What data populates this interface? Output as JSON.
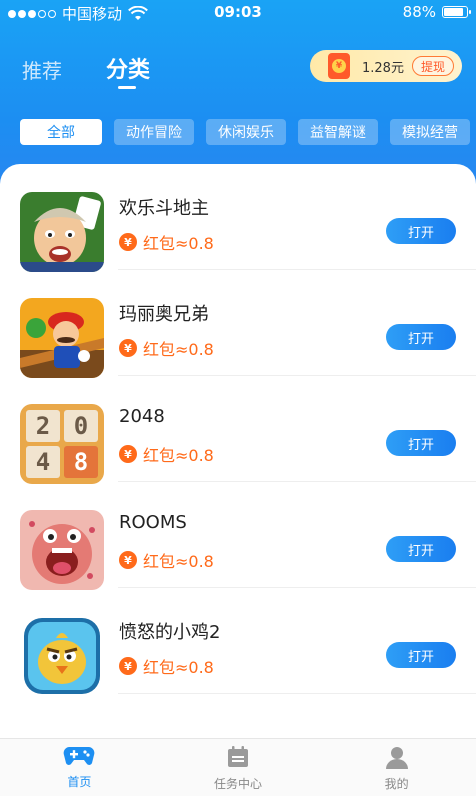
{
  "status_bar": {
    "carrier": "中国移动",
    "time": "09:03",
    "battery": "88%"
  },
  "top_tabs": [
    {
      "label": "推荐",
      "active": false
    },
    {
      "label": "分类",
      "active": true
    }
  ],
  "reward_pill": {
    "amount": "1.28元",
    "withdraw_label": "提现",
    "icon_glyph": "¥"
  },
  "categories": [
    {
      "label": "全部",
      "active": true
    },
    {
      "label": "动作冒险",
      "active": false
    },
    {
      "label": "休闲娱乐",
      "active": false
    },
    {
      "label": "益智解谜",
      "active": false
    },
    {
      "label": "模拟经营",
      "active": false
    }
  ],
  "games": [
    {
      "name": "欢乐斗地主",
      "reward": "红包≈0.8",
      "button": "打开",
      "icon": "doudizhu-icon"
    },
    {
      "name": "玛丽奥兄弟",
      "reward": "红包≈0.8",
      "button": "打开",
      "icon": "mario-icon"
    },
    {
      "name": "2048",
      "reward": "红包≈0.8",
      "button": "打开",
      "icon": "2048-icon",
      "tiles": [
        "2",
        "0",
        "4",
        "8"
      ]
    },
    {
      "name": "ROOMS",
      "reward": "红包≈0.8",
      "button": "打开",
      "icon": "rooms-icon"
    },
    {
      "name": "愤怒的小鸡2",
      "reward": "红包≈0.8",
      "button": "打开",
      "icon": "angry-chick-icon"
    }
  ],
  "yen_glyph": "¥",
  "bottom_nav": [
    {
      "label": "首页",
      "active": true,
      "icon": "gamepad-icon"
    },
    {
      "label": "任务中心",
      "active": false,
      "icon": "calendar-icon"
    },
    {
      "label": "我的",
      "active": false,
      "icon": "user-icon"
    }
  ],
  "colors": {
    "primary": "#1d8ff2",
    "reward_orange": "#ff6a1a"
  }
}
